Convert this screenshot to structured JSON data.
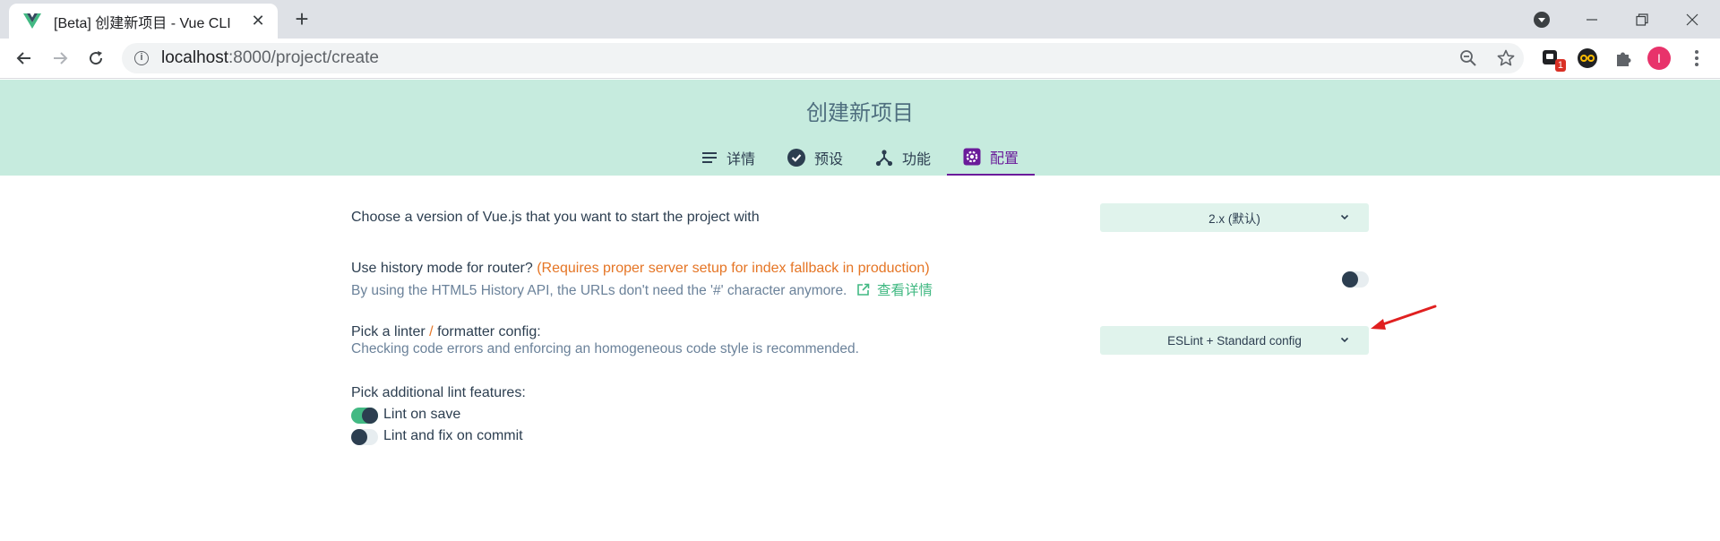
{
  "browser": {
    "tab_title": "[Beta] 创建新项目 - Vue CLI",
    "url_host": "localhost",
    "url_rest": ":8000/project/create",
    "extension_badge": "1",
    "profile_initial": "I"
  },
  "header": {
    "title": "创建新项目",
    "tabs": [
      {
        "label": "详情",
        "icon": "list-icon"
      },
      {
        "label": "预设",
        "icon": "check-circle-icon"
      },
      {
        "label": "功能",
        "icon": "fork-icon"
      },
      {
        "label": "配置",
        "icon": "settings-icon",
        "active": true
      }
    ]
  },
  "config": {
    "vue_version": {
      "label": "Choose a version of Vue.js that you want to start the project with",
      "value": "2.x (默认)"
    },
    "history_mode": {
      "label": "Use history mode for router?",
      "warning": "(Requires proper server setup for index fallback in production)",
      "description": "By using the HTML5 History API, the URLs don't need the '#' character anymore.",
      "link_text": "查看详情",
      "enabled": false
    },
    "linter": {
      "label_part1": "Pick a linter",
      "label_sep": "/",
      "label_part2": "formatter config:",
      "description": "Checking code errors and enforcing an homogeneous code style is recommended.",
      "value": "ESLint + Standard config"
    },
    "lint_features": {
      "label": "Pick additional lint features:",
      "options": [
        {
          "label": "Lint on save",
          "checked": true
        },
        {
          "label": "Lint and fix on commit",
          "checked": false
        }
      ]
    }
  },
  "colors": {
    "header_bg": "#c6ebde",
    "accent_green": "#42b983",
    "active_tab": "#6a1b9a",
    "warning": "#e57525",
    "annotation_arrow": "#e02020"
  }
}
